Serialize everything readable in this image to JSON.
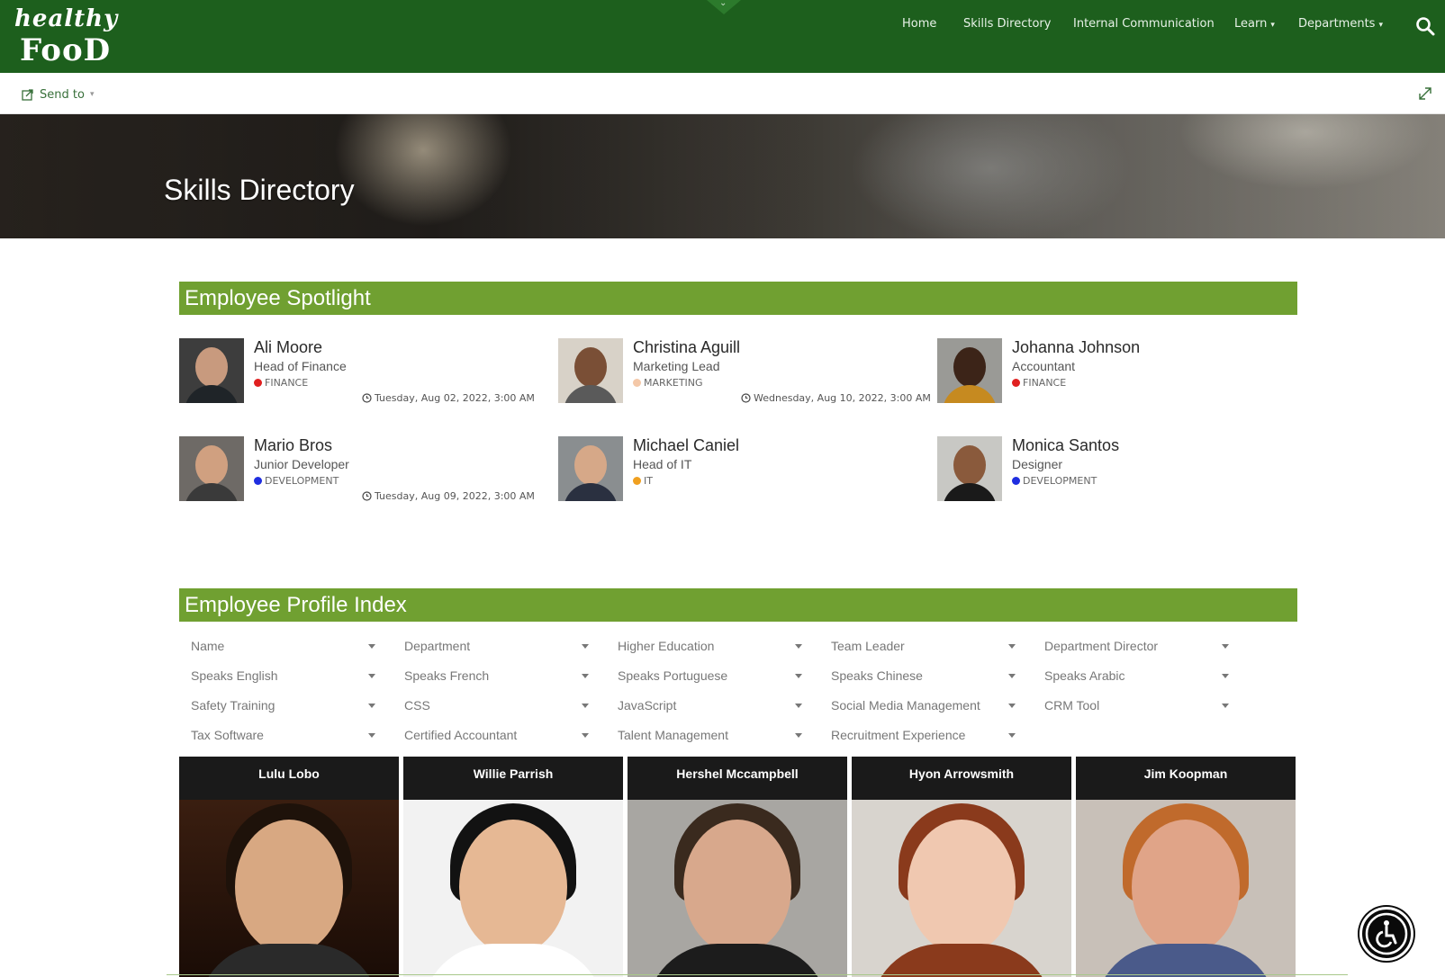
{
  "logo": {
    "line1": "healthy",
    "line2": "FooD"
  },
  "nav": {
    "home": "Home",
    "skills": "Skills Directory",
    "comms": "Internal Communication",
    "learn": "Learn",
    "departments": "Departments"
  },
  "cmdbar": {
    "send_to": "Send to"
  },
  "hero": {
    "title": "Skills Directory"
  },
  "spotlight": {
    "header": "Employee Spotlight",
    "people": [
      {
        "name": "Ali Moore",
        "role": "Head of Finance",
        "dept": "FINANCE",
        "dept_color": "#e02020",
        "date": "Tuesday, Aug 02, 2022, 3:00 AM"
      },
      {
        "name": "Christina Aguill",
        "role": "Marketing Lead",
        "dept": "MARKETING",
        "dept_color": "#f4c8a8",
        "date": "Wednesday, Aug 10, 2022, 3:00 AM"
      },
      {
        "name": "Johanna Johnson",
        "role": "Accountant",
        "dept": "FINANCE",
        "dept_color": "#e02020",
        "date": ""
      },
      {
        "name": "Mario Bros",
        "role": "Junior Developer",
        "dept": "DEVELOPMENT",
        "dept_color": "#1f2ee0",
        "date": "Tuesday, Aug 09, 2022, 3:00 AM"
      },
      {
        "name": "Michael Caniel",
        "role": "Head of IT",
        "dept": "IT",
        "dept_color": "#f0a020",
        "date": ""
      },
      {
        "name": "Monica Santos",
        "role": "Designer",
        "dept": "DEVELOPMENT",
        "dept_color": "#1f2ee0",
        "date": ""
      }
    ]
  },
  "index": {
    "header": "Employee Profile Index",
    "filters": [
      "Name",
      "Department",
      "Higher Education",
      "Team Leader",
      "Department Director",
      "Speaks English",
      "Speaks French",
      "Speaks Portuguese",
      "Speaks Chinese",
      "Speaks Arabic",
      "Safety Training",
      "CSS",
      "JavaScript",
      "Social Media Management",
      "CRM Tool",
      "Tax Software",
      "Certified Accountant",
      "Talent Management",
      "Recruitment Experience"
    ],
    "profiles": [
      {
        "name": "Lulu Lobo"
      },
      {
        "name": "Willie Parrish"
      },
      {
        "name": "Hershel Mccampbell"
      },
      {
        "name": "Hyon Arrowsmith"
      },
      {
        "name": "Jim Koopman"
      }
    ]
  },
  "colors": {
    "nav_green": "#1d5f1d",
    "section_green": "#70a031",
    "link_green": "#38703a"
  }
}
